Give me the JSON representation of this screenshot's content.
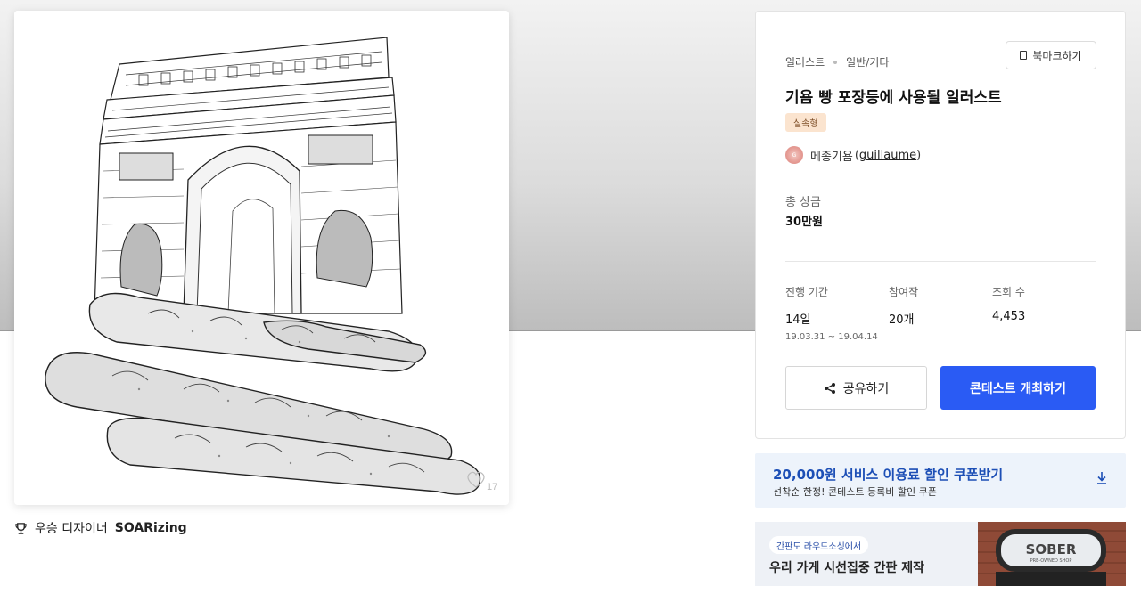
{
  "artwork": {
    "watermark_count": "17"
  },
  "winner": {
    "prefix": "우승 디자이너",
    "name": "SOARizing"
  },
  "contest": {
    "category": "일러스트",
    "subcategory": "일반/기타",
    "bookmark_label": "북마크하기",
    "title": "기욤 빵 포장등에 사용될 일러스트",
    "type_badge": "실속형",
    "host_name": "메종기욤",
    "host_id": "guillaume",
    "prize_label": "총 상금",
    "prize_value": "30만원",
    "stats": [
      {
        "label": "진행 기간",
        "value": "14일",
        "sub": "19.03.31 ~ 19.04.14"
      },
      {
        "label": "참여작",
        "value": "20개"
      },
      {
        "label": "조회 수",
        "value": "4,453"
      }
    ],
    "share_label": "공유하기",
    "host_contest_label": "콘테스트 개최하기"
  },
  "coupon": {
    "title": "20,000원 서비스 이용료 할인 쿠폰받기",
    "subtitle": "선착순 한정! 콘테스트 등록비 할인 쿠폰"
  },
  "ad": {
    "chip": "간판도 라우드소싱에서",
    "title": "우리 가게 시선집중 간판 제작",
    "sign_text": "SOBER",
    "sign_sub": "PRE-OWNED SHOP"
  },
  "colors": {
    "primary": "#2a5bf4",
    "coupon_text": "#1d4fb6",
    "badge_bg": "#fbe4cf"
  }
}
